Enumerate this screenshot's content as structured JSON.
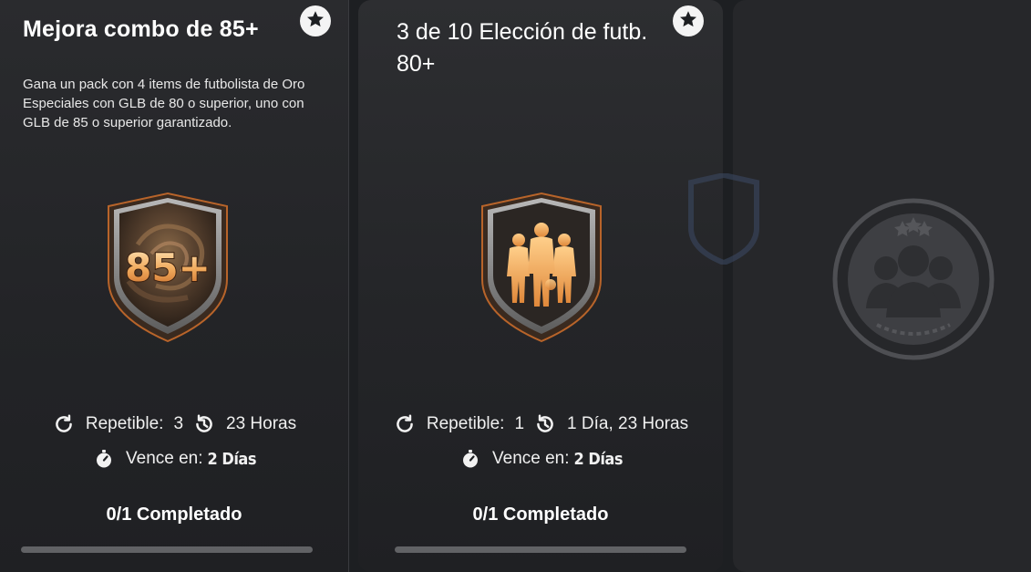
{
  "cards": [
    {
      "title": "Mejora combo de 85+",
      "description": "Gana un pack con 4 items de futbolista de Oro Especiales con GLB de 80 o superior, uno con GLB de 85 o superior garantizado.",
      "badge_text": "85+",
      "repeat_label": "Repetible:",
      "repeat_value": "3",
      "time_left": "23 Horas",
      "expire_label": "Vence en:",
      "expire_value": "2 Días",
      "completion": "0/1 Completado",
      "progress": 0
    },
    {
      "title": "3 de 10 Elección de futb. 80+",
      "repeat_label": "Repetible:",
      "repeat_value": "1",
      "time_left": "1 Día, 23 Horas",
      "expire_label": "Vence en:",
      "expire_value": "2 Días",
      "completion": "0/1 Completado",
      "progress": 0
    }
  ],
  "icons": {
    "favorite": "star-icon",
    "repeat": "refresh-icon",
    "time": "history-clock-icon",
    "expire": "stopwatch-icon"
  },
  "colors": {
    "accent": "#e0a24a",
    "card_bg": "#27282b",
    "progress_track": "#616265"
  }
}
